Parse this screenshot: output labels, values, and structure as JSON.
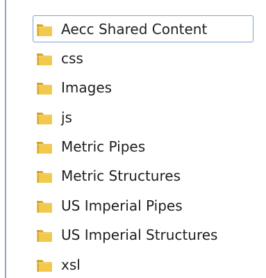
{
  "folders": [
    {
      "name": "Aecc Shared Content",
      "icon": "folder-icon",
      "selected": true
    },
    {
      "name": "css",
      "icon": "folder-icon",
      "selected": false
    },
    {
      "name": "Images",
      "icon": "folder-icon",
      "selected": false
    },
    {
      "name": "js",
      "icon": "folder-icon",
      "selected": false
    },
    {
      "name": "Metric Pipes",
      "icon": "folder-icon",
      "selected": false
    },
    {
      "name": "Metric Structures",
      "icon": "folder-icon",
      "selected": false
    },
    {
      "name": "US Imperial Pipes",
      "icon": "folder-icon",
      "selected": false
    },
    {
      "name": "US Imperial Structures",
      "icon": "folder-icon",
      "selected": false
    },
    {
      "name": "xsl",
      "icon": "folder-icon",
      "selected": false
    }
  ],
  "colors": {
    "selection_border": "#7da2ce",
    "folder_yellow": "#f2c94c",
    "text": "#1e1e1e"
  }
}
